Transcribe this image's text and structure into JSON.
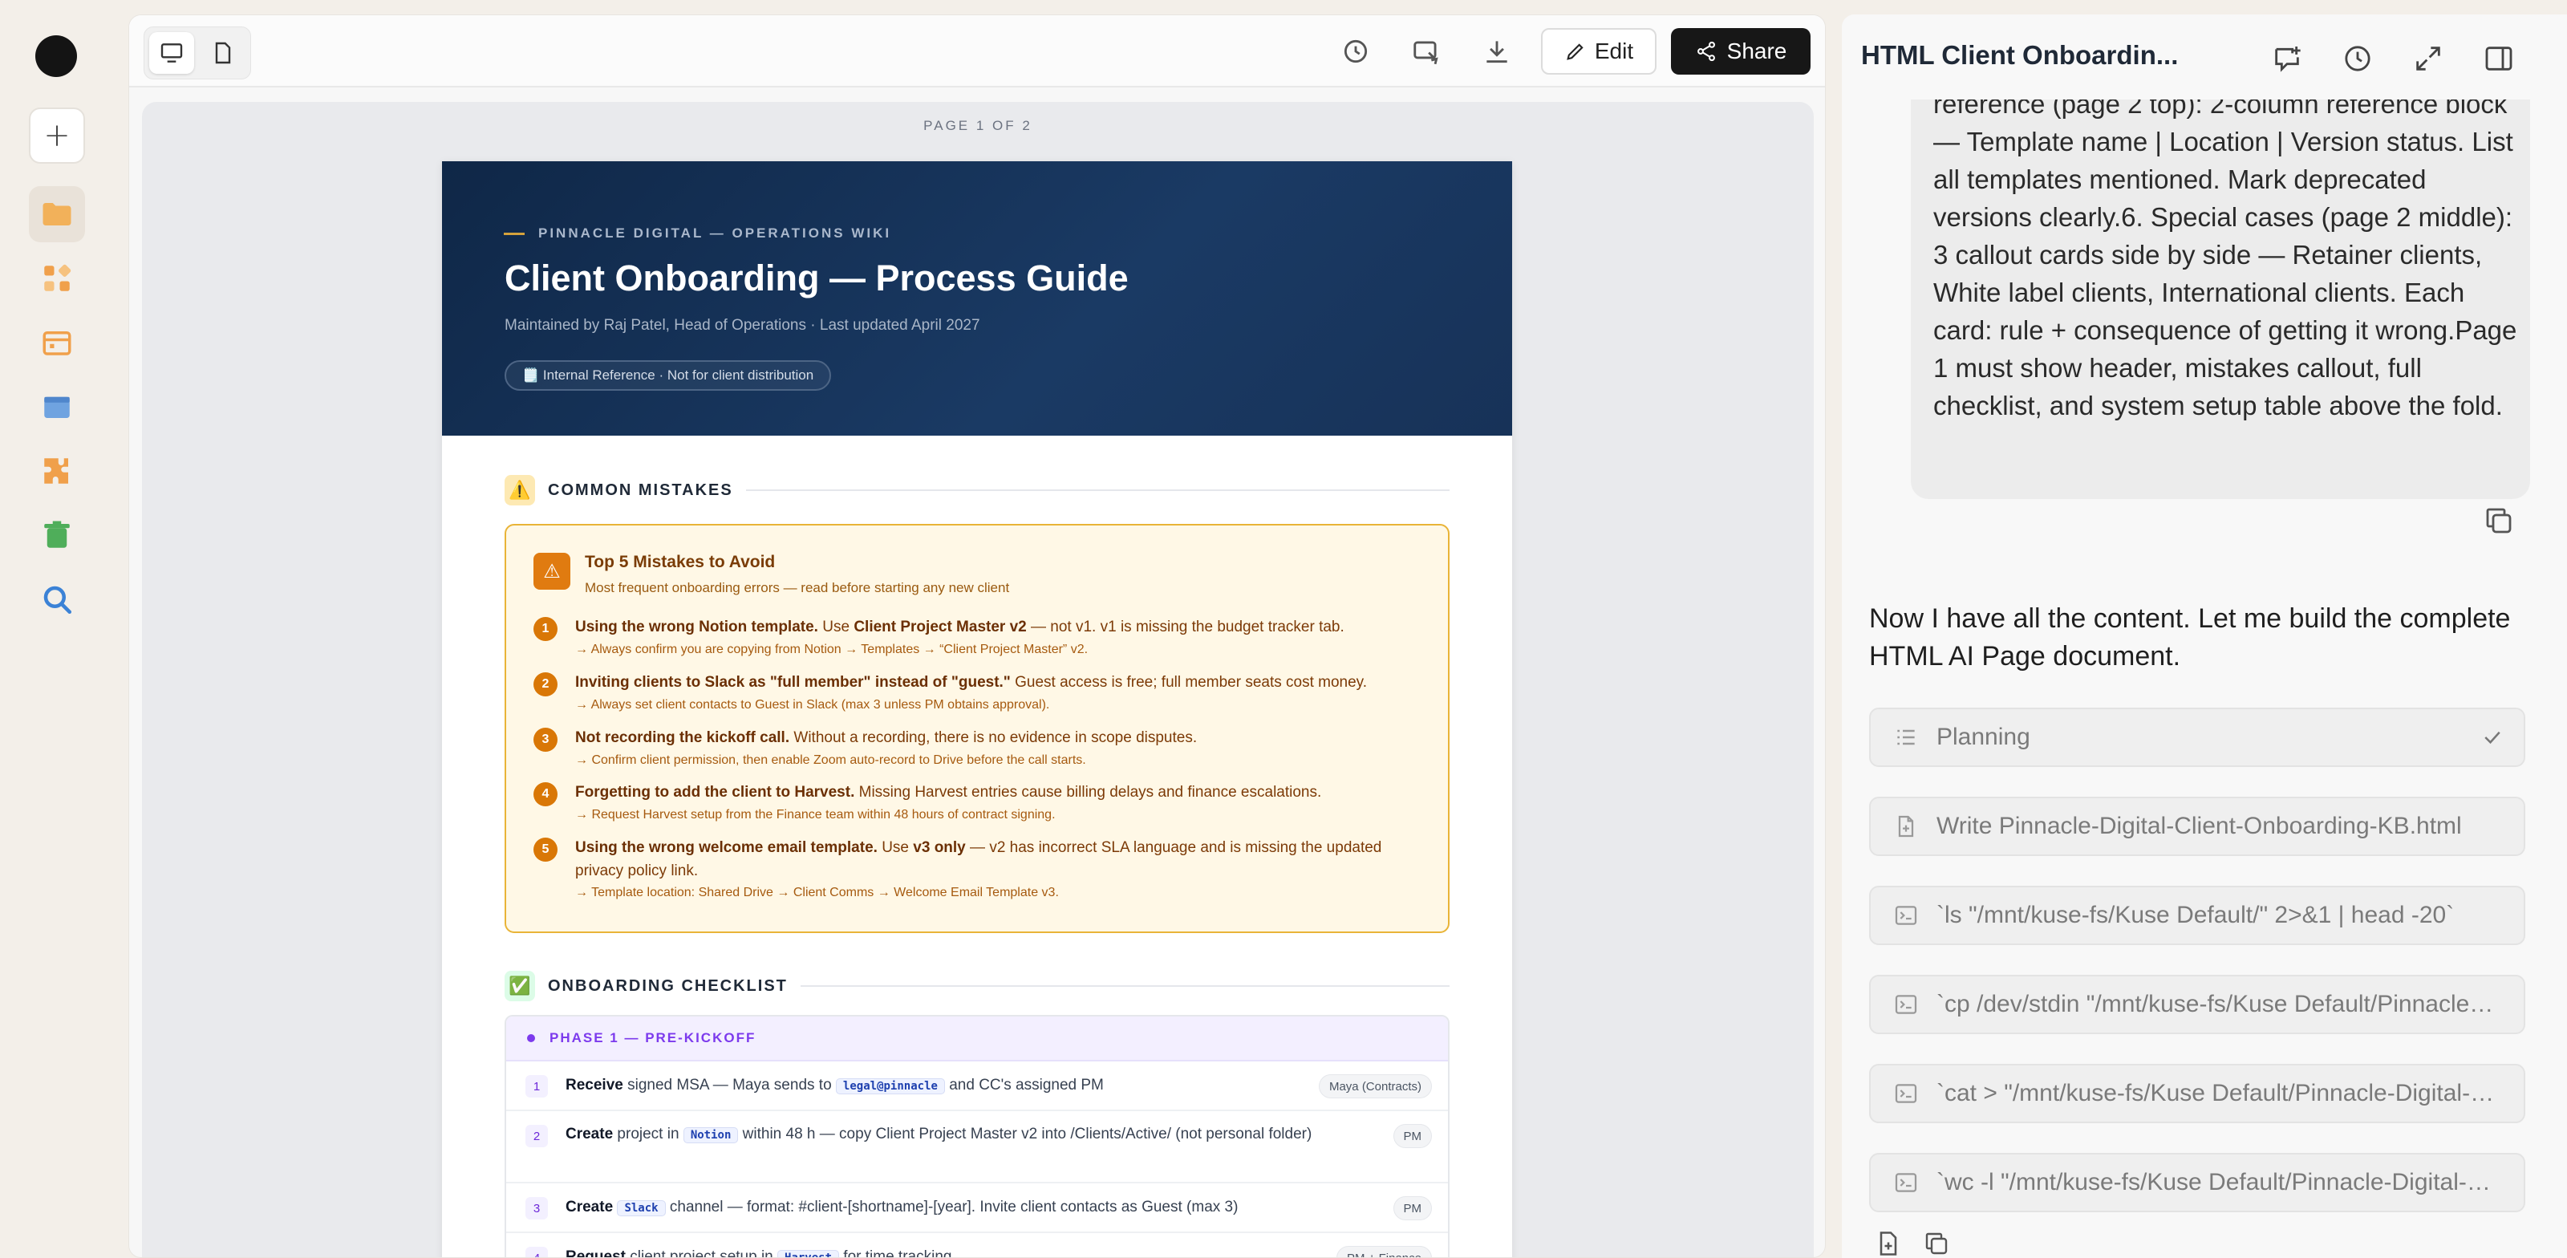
{
  "toolbar": {
    "edit_label": "Edit",
    "share_label": "Share"
  },
  "document": {
    "page_label": "PAGE 1 OF 2",
    "eyebrow": "PINNACLE DIGITAL — OPERATIONS WIKI",
    "title": "Client Onboarding — Process Guide",
    "meta": "Maintained by Raj Patel, Head of Operations  ·  Last updated April 2027",
    "badge": "🗒️ Internal Reference · Not for client distribution",
    "mistakes_section": "COMMON MISTAKES",
    "mistakes_icon": "⚠️",
    "mistakes_title": "Top 5 Mistakes to Avoid",
    "mistakes_sub": "Most frequent onboarding errors — read before starting any new client",
    "mistakes": [
      {
        "num": "1",
        "bold": "Using the wrong Notion template.",
        "rest": " Use ",
        "bold2": "Client Project Master v2",
        "rest2": " — not v1. v1 is missing the budget tracker tab.",
        "tip": "→ Always confirm you are copying from Notion → Templates → “Client Project Master” v2."
      },
      {
        "num": "2",
        "bold": "Inviting clients to Slack as \"full member\" instead of \"guest.\"",
        "rest": " Guest access is free; full member seats cost money.",
        "bold2": "",
        "rest2": "",
        "tip": "→ Always set client contacts to Guest in Slack (max 3 unless PM obtains approval)."
      },
      {
        "num": "3",
        "bold": "Not recording the kickoff call.",
        "rest": " Without a recording, there is no evidence in scope disputes.",
        "bold2": "",
        "rest2": "",
        "tip": "→ Confirm client permission, then enable Zoom auto-record to Drive before the call starts."
      },
      {
        "num": "4",
        "bold": "Forgetting to add the client to Harvest.",
        "rest": " Missing Harvest entries cause billing delays and finance escalations.",
        "bold2": "",
        "rest2": "",
        "tip": "→ Request Harvest setup from the Finance team within 48 hours of contract signing."
      },
      {
        "num": "5",
        "bold": "Using the wrong welcome email template.",
        "rest": " Use ",
        "bold2": "v3 only",
        "rest2": " — v2 has incorrect SLA language and is missing the updated privacy policy link.",
        "tip": "→ Template location: Shared Drive → Client Comms → Welcome Email Template v3."
      }
    ],
    "checklist_section": "ONBOARDING CHECKLIST",
    "checklist_icon": "✅",
    "phase": "PHASE 1 — PRE-KICKOFF",
    "checklist": [
      {
        "num": "1",
        "verb": "Receive",
        "text_a": " signed MSA — Maya sends to ",
        "code": "legal@pinnacle",
        "text_b": " and CC's assigned PM",
        "tag": "Maya (Contracts)"
      },
      {
        "num": "2",
        "verb": "Create",
        "text_a": " project in ",
        "code": "Notion",
        "text_b": " within 48 h — copy Client Project Master v2 into /Clients/Active/ (not personal folder)",
        "tag": "PM"
      },
      {
        "num": "3",
        "verb": "Create",
        "text_a": " ",
        "code": "Slack",
        "text_b": " channel — format: #client-[shortname]-[year]. Invite client contacts as Guest (max 3)",
        "tag": "PM"
      },
      {
        "num": "4",
        "verb": "Request",
        "text_a": " client project setup in ",
        "code": "Harvest",
        "text_b": " for time tracking",
        "tag": "PM + Finance"
      }
    ]
  },
  "sidebar": {
    "title": "HTML Client Onboardin...",
    "user_message": "reference (page 2 top): 2-column reference block — Template name | Location | Version status. List all templates mentioned. Mark deprecated versions clearly.6. Special cases (page 2 middle): 3 callout cards side by side — Retainer clients, White label clients, International clients. Each card: rule + consequence of getting it wrong.Page 1 must show header, mistakes callout, full checklist, and system setup table above the fold.",
    "assistant_reply": "Now I have all the content. Let me build the complete HTML AI Page document.",
    "steps": [
      {
        "label": "Planning",
        "icon": "list-icon"
      },
      {
        "label": "Write Pinnacle-Digital-Client-Onboarding-KB.html",
        "icon": "file-icon"
      },
      {
        "label": "`ls \"/mnt/kuse-fs/Kuse Default/\" 2>&1 | head -20`",
        "icon": "terminal-icon"
      },
      {
        "label": "`cp /dev/stdin \"/mnt/kuse-fs/Kuse Default/Pinnacle-Digital-Client-Onboarding-KB.html\"`",
        "icon": "terminal-icon"
      },
      {
        "label": "`cat > \"/mnt/kuse-fs/Kuse Default/Pinnacle-Digital-Client-Onboarding-KB.html\"`",
        "icon": "terminal-icon"
      },
      {
        "label": "`wc -l \"/mnt/kuse-fs/Kuse Default/Pinnacle-Digital-Client-Onboarding-KB.html\"`",
        "icon": "terminal-icon"
      }
    ]
  }
}
